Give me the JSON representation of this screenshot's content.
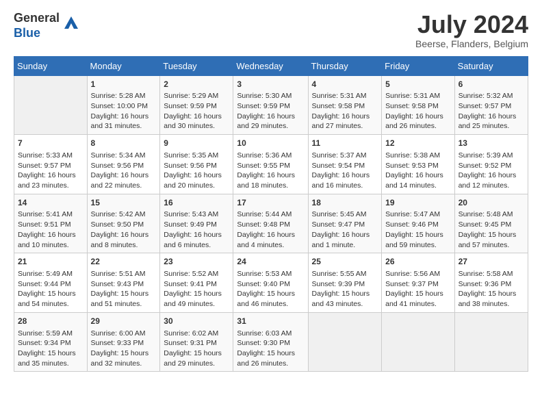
{
  "header": {
    "logo_line1": "General",
    "logo_line2": "Blue",
    "month_title": "July 2024",
    "location": "Beerse, Flanders, Belgium"
  },
  "days_of_week": [
    "Sunday",
    "Monday",
    "Tuesday",
    "Wednesday",
    "Thursday",
    "Friday",
    "Saturday"
  ],
  "weeks": [
    [
      {
        "day": "",
        "info": ""
      },
      {
        "day": "1",
        "info": "Sunrise: 5:28 AM\nSunset: 10:00 PM\nDaylight: 16 hours\nand 31 minutes."
      },
      {
        "day": "2",
        "info": "Sunrise: 5:29 AM\nSunset: 9:59 PM\nDaylight: 16 hours\nand 30 minutes."
      },
      {
        "day": "3",
        "info": "Sunrise: 5:30 AM\nSunset: 9:59 PM\nDaylight: 16 hours\nand 29 minutes."
      },
      {
        "day": "4",
        "info": "Sunrise: 5:31 AM\nSunset: 9:58 PM\nDaylight: 16 hours\nand 27 minutes."
      },
      {
        "day": "5",
        "info": "Sunrise: 5:31 AM\nSunset: 9:58 PM\nDaylight: 16 hours\nand 26 minutes."
      },
      {
        "day": "6",
        "info": "Sunrise: 5:32 AM\nSunset: 9:57 PM\nDaylight: 16 hours\nand 25 minutes."
      }
    ],
    [
      {
        "day": "7",
        "info": "Sunrise: 5:33 AM\nSunset: 9:57 PM\nDaylight: 16 hours\nand 23 minutes."
      },
      {
        "day": "8",
        "info": "Sunrise: 5:34 AM\nSunset: 9:56 PM\nDaylight: 16 hours\nand 22 minutes."
      },
      {
        "day": "9",
        "info": "Sunrise: 5:35 AM\nSunset: 9:56 PM\nDaylight: 16 hours\nand 20 minutes."
      },
      {
        "day": "10",
        "info": "Sunrise: 5:36 AM\nSunset: 9:55 PM\nDaylight: 16 hours\nand 18 minutes."
      },
      {
        "day": "11",
        "info": "Sunrise: 5:37 AM\nSunset: 9:54 PM\nDaylight: 16 hours\nand 16 minutes."
      },
      {
        "day": "12",
        "info": "Sunrise: 5:38 AM\nSunset: 9:53 PM\nDaylight: 16 hours\nand 14 minutes."
      },
      {
        "day": "13",
        "info": "Sunrise: 5:39 AM\nSunset: 9:52 PM\nDaylight: 16 hours\nand 12 minutes."
      }
    ],
    [
      {
        "day": "14",
        "info": "Sunrise: 5:41 AM\nSunset: 9:51 PM\nDaylight: 16 hours\nand 10 minutes."
      },
      {
        "day": "15",
        "info": "Sunrise: 5:42 AM\nSunset: 9:50 PM\nDaylight: 16 hours\nand 8 minutes."
      },
      {
        "day": "16",
        "info": "Sunrise: 5:43 AM\nSunset: 9:49 PM\nDaylight: 16 hours\nand 6 minutes."
      },
      {
        "day": "17",
        "info": "Sunrise: 5:44 AM\nSunset: 9:48 PM\nDaylight: 16 hours\nand 4 minutes."
      },
      {
        "day": "18",
        "info": "Sunrise: 5:45 AM\nSunset: 9:47 PM\nDaylight: 16 hours\nand 1 minute."
      },
      {
        "day": "19",
        "info": "Sunrise: 5:47 AM\nSunset: 9:46 PM\nDaylight: 15 hours\nand 59 minutes."
      },
      {
        "day": "20",
        "info": "Sunrise: 5:48 AM\nSunset: 9:45 PM\nDaylight: 15 hours\nand 57 minutes."
      }
    ],
    [
      {
        "day": "21",
        "info": "Sunrise: 5:49 AM\nSunset: 9:44 PM\nDaylight: 15 hours\nand 54 minutes."
      },
      {
        "day": "22",
        "info": "Sunrise: 5:51 AM\nSunset: 9:43 PM\nDaylight: 15 hours\nand 51 minutes."
      },
      {
        "day": "23",
        "info": "Sunrise: 5:52 AM\nSunset: 9:41 PM\nDaylight: 15 hours\nand 49 minutes."
      },
      {
        "day": "24",
        "info": "Sunrise: 5:53 AM\nSunset: 9:40 PM\nDaylight: 15 hours\nand 46 minutes."
      },
      {
        "day": "25",
        "info": "Sunrise: 5:55 AM\nSunset: 9:39 PM\nDaylight: 15 hours\nand 43 minutes."
      },
      {
        "day": "26",
        "info": "Sunrise: 5:56 AM\nSunset: 9:37 PM\nDaylight: 15 hours\nand 41 minutes."
      },
      {
        "day": "27",
        "info": "Sunrise: 5:58 AM\nSunset: 9:36 PM\nDaylight: 15 hours\nand 38 minutes."
      }
    ],
    [
      {
        "day": "28",
        "info": "Sunrise: 5:59 AM\nSunset: 9:34 PM\nDaylight: 15 hours\nand 35 minutes."
      },
      {
        "day": "29",
        "info": "Sunrise: 6:00 AM\nSunset: 9:33 PM\nDaylight: 15 hours\nand 32 minutes."
      },
      {
        "day": "30",
        "info": "Sunrise: 6:02 AM\nSunset: 9:31 PM\nDaylight: 15 hours\nand 29 minutes."
      },
      {
        "day": "31",
        "info": "Sunrise: 6:03 AM\nSunset: 9:30 PM\nDaylight: 15 hours\nand 26 minutes."
      },
      {
        "day": "",
        "info": ""
      },
      {
        "day": "",
        "info": ""
      },
      {
        "day": "",
        "info": ""
      }
    ]
  ]
}
